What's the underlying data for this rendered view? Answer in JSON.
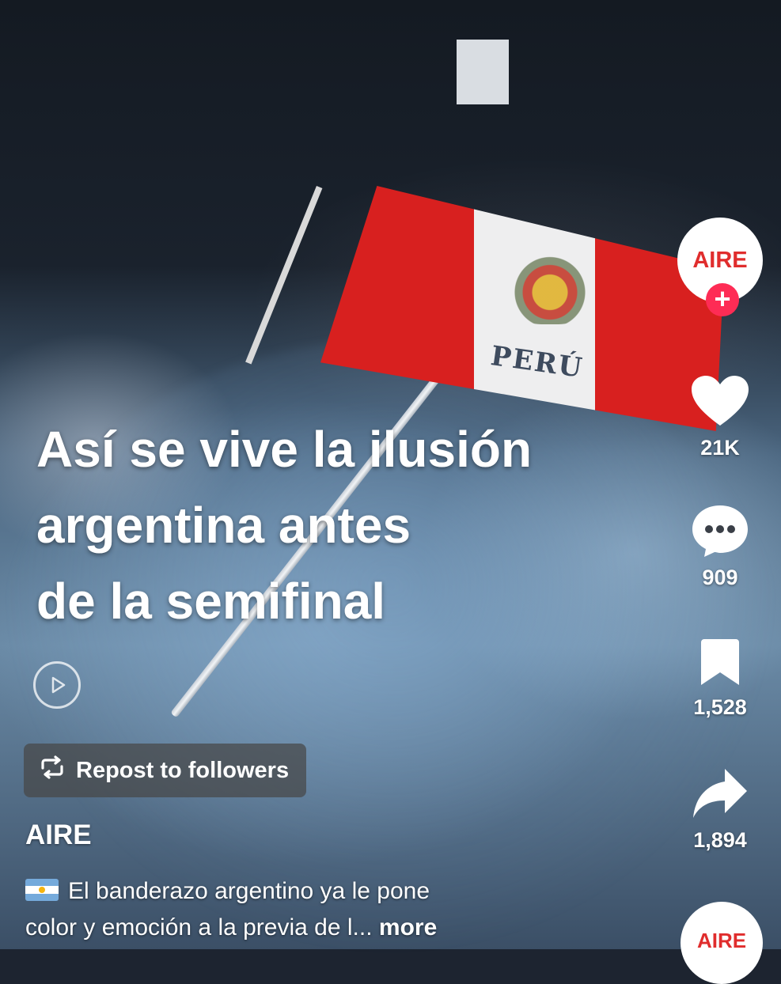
{
  "overlay": {
    "lines": [
      "Así se vive la ilusión",
      "argentina antes",
      "de la semifinal"
    ]
  },
  "flag_text": "PERÚ",
  "repost": {
    "label": "Repost to followers",
    "icon": "repost-icon"
  },
  "account": {
    "avatar_text": "AIRE",
    "follow_icon": "plus-icon"
  },
  "actions": {
    "likes": "21K",
    "comments": "909",
    "saves": "1,528",
    "shares": "1,894"
  },
  "author": "AIRE",
  "description": {
    "line1": "El banderazo argentino ya le pone",
    "line2": "color y emoción a la previa de l...",
    "more": "more",
    "emoji": "argentina-flag-emoji"
  },
  "next_avatar_text": "AIRE",
  "colors": {
    "accent": "#fe2c55",
    "brand_red": "#e02d2d",
    "text": "#ffffff"
  }
}
